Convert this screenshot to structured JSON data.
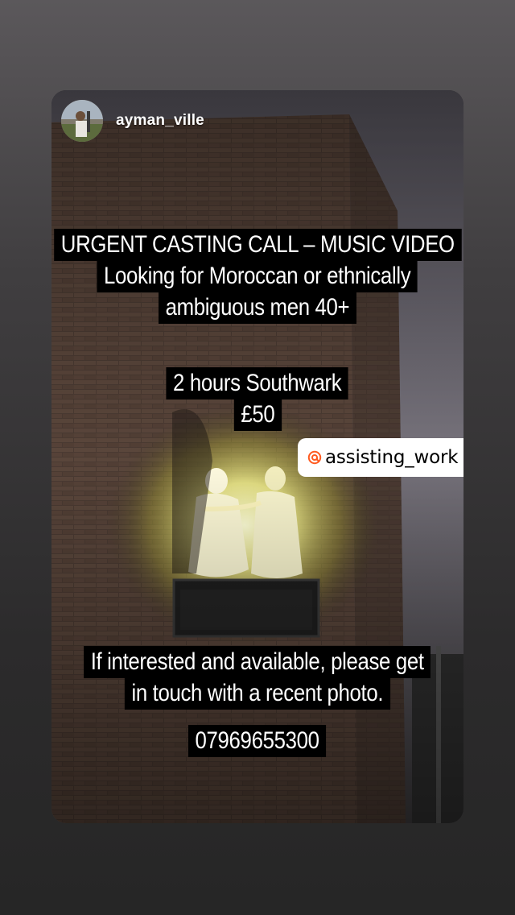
{
  "story": {
    "username": "ayman_ville",
    "mention": "assisting_work",
    "caption_group_1": [
      "URGENT CASTING CALL – MUSIC VIDEO",
      "Looking for Moroccan or ethnically",
      "ambiguous men 40+"
    ],
    "caption_group_2": [
      "2 hours Southwark",
      "£50"
    ],
    "caption_group_3": [
      "If interested and available, please get",
      "in touch with a recent photo."
    ],
    "phone": "07969655300"
  },
  "icons": {
    "mention": "threads-at-icon",
    "avatar": "profile-photo"
  },
  "colors": {
    "caption_bg": "#000000",
    "caption_text": "#ffffff",
    "mention_bg": "#ffffff",
    "mention_accent": "#ff5a1f"
  }
}
